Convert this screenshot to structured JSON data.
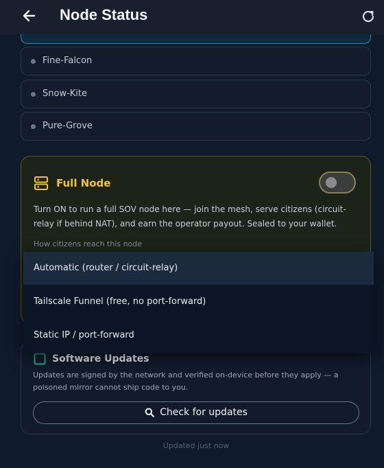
{
  "header": {
    "title": "Node Status"
  },
  "peers": [
    {
      "name": "Fine-Falcon"
    },
    {
      "name": "Snow-Kite"
    },
    {
      "name": "Pure-Grove"
    }
  ],
  "full_node": {
    "title": "Full Node",
    "enabled": false,
    "description": "Turn ON to run a full SOV node here — join the mesh, serve citizens (circuit-relay if behind NAT), and earn the operator payout. Sealed to your wallet.",
    "reach_label": "How citizens reach this node",
    "options": [
      "Automatic (router / circuit-relay)",
      "Tailscale Funnel (free, no port-forward)",
      "Static IP / port-forward"
    ],
    "selected_option": "Automatic (router / circuit-relay)"
  },
  "software_updates": {
    "title": "Software Updates",
    "description": "Updates are signed by the network and verified on-device before they apply — a poisoned mirror cannot ship code to you.",
    "button_label": "Check for updates"
  },
  "footer": {
    "updated_text": "Updated just now"
  },
  "colors": {
    "accent": "#f0c22e",
    "background": "#0f1a2b",
    "update_icon": "#1fae8a"
  }
}
